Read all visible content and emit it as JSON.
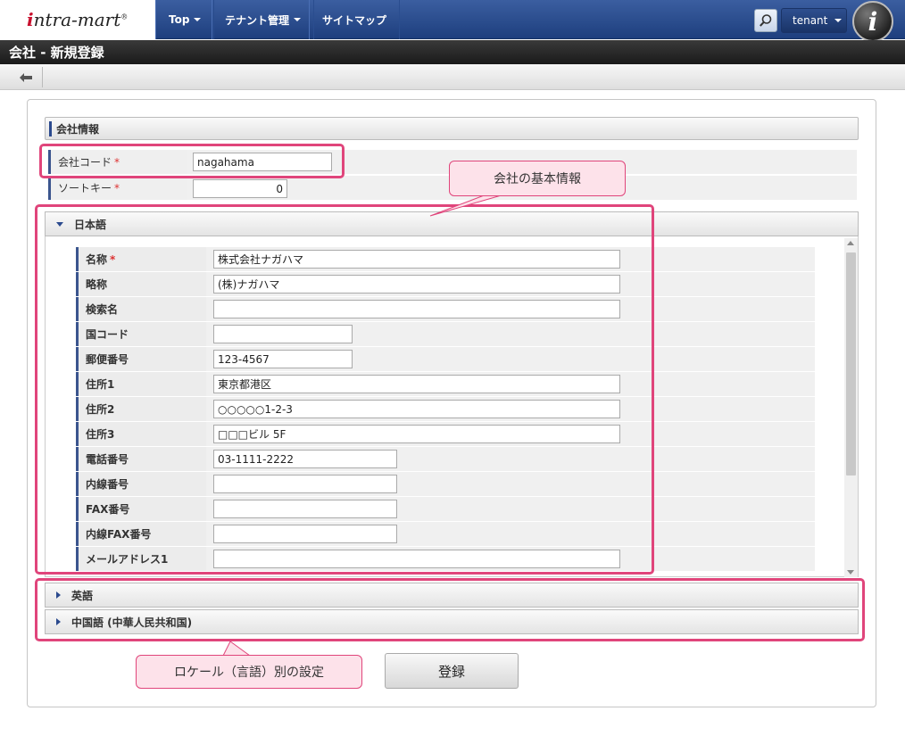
{
  "app": {
    "logo_main": "ntra-mart",
    "logo_i": "i",
    "logo_reg": "®"
  },
  "nav": {
    "items": [
      {
        "label": "Top"
      },
      {
        "label": "テナント管理"
      },
      {
        "label": "サイトマップ"
      }
    ],
    "tenant_label": "tenant",
    "avatar_letter": "i"
  },
  "page": {
    "title": "会社 - 新規登録",
    "back_glyph": "🡐"
  },
  "company_info": {
    "section_title": "会社情報",
    "company_code": {
      "label": "会社コード",
      "required_mark": "*",
      "value": "nagahama"
    },
    "sort_key": {
      "label": "ソートキー",
      "required_mark": "*",
      "value": "0"
    }
  },
  "locales": {
    "japanese": {
      "title": "日本語",
      "fields": [
        {
          "label": "名称",
          "required_mark": "*",
          "value": "株式会社ナガハマ"
        },
        {
          "label": "略称",
          "required_mark": "",
          "value": "(株)ナガハマ"
        },
        {
          "label": "検索名",
          "required_mark": "",
          "value": ""
        },
        {
          "label": "国コード",
          "required_mark": "",
          "value": ""
        },
        {
          "label": "郵便番号",
          "required_mark": "",
          "value": "123-4567"
        },
        {
          "label": "住所1",
          "required_mark": "",
          "value": "東京都港区"
        },
        {
          "label": "住所2",
          "required_mark": "",
          "value": "○○○○○1-2-3"
        },
        {
          "label": "住所3",
          "required_mark": "",
          "value": "□□□ビル 5F"
        },
        {
          "label": "電話番号",
          "required_mark": "",
          "value": "03-1111-2222"
        },
        {
          "label": "内線番号",
          "required_mark": "",
          "value": ""
        },
        {
          "label": "FAX番号",
          "required_mark": "",
          "value": ""
        },
        {
          "label": "内線FAX番号",
          "required_mark": "",
          "value": ""
        },
        {
          "label": "メールアドレス1",
          "required_mark": "",
          "value": ""
        }
      ]
    },
    "english": {
      "title": "英語"
    },
    "chinese": {
      "title": "中国語 (中華人民共和国)"
    }
  },
  "annotations": {
    "basic_info": "会社の基本情報",
    "locale_settings": "ロケール（言語）別の設定"
  },
  "submit_label": "登録",
  "colors": {
    "accent": "#e0457b",
    "nav": "#2b4a8e"
  }
}
